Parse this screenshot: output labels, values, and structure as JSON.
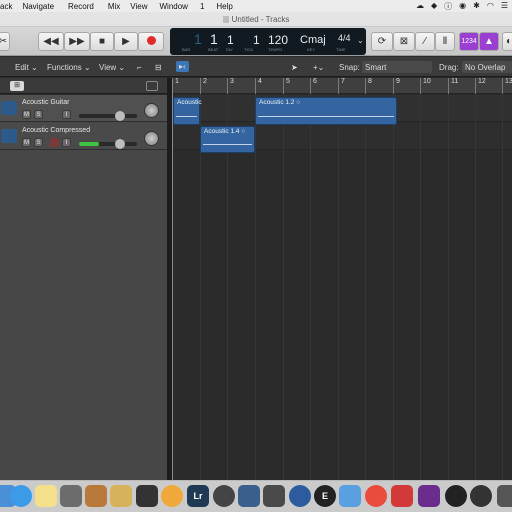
{
  "menubar": {
    "items": [
      "ack",
      "Navigate",
      "Record",
      "Mix",
      "View",
      "Window",
      "1",
      "Help"
    ],
    "status_icons": [
      "cloud-icon",
      "shield-icon",
      "info-icon",
      "circle-icon",
      "bluetooth-icon",
      "wifi-icon",
      "list-icon"
    ]
  },
  "window": {
    "title": "Untitled - Tracks"
  },
  "transport": {
    "bar": "1",
    "beat": "1",
    "div": "1",
    "tick": "1",
    "bar_label": "BAR",
    "beat_label": "BEAT",
    "div_label": "DIV",
    "tick_label": "TICK",
    "tempo": "120",
    "tempo_label": "TEMPO",
    "key": "Cmaj",
    "key_label": "KEY",
    "time_sig": "4/4",
    "time_label": "TIME",
    "count_in": "1234"
  },
  "secondbar": {
    "edit": "Edit",
    "functions": "Functions",
    "view": "View",
    "snap_label": "Snap:",
    "snap_value": "Smart",
    "drag_label": "Drag:",
    "drag_value": "No Overlap"
  },
  "ruler": {
    "ticks": [
      "1",
      "2",
      "3",
      "4",
      "5",
      "6",
      "7",
      "8",
      "9",
      "10",
      "11",
      "12",
      "13"
    ]
  },
  "tracks": [
    {
      "name": "Acoustic Guitar",
      "mute": "M",
      "solo": "S",
      "input": "I"
    },
    {
      "name": "Acoustic Compressed",
      "mute": "M",
      "solo": "S",
      "input": "I"
    }
  ],
  "regions": [
    {
      "name": "Acoustic",
      "track": 1
    },
    {
      "name": "Acoustic 1.2",
      "track": 1
    },
    {
      "name": "Acoustic 1.4",
      "track": 2
    }
  ],
  "dock": [
    "Lr",
    "E"
  ],
  "colors": {
    "region": "#3565a0",
    "accent": "#b04ad9"
  }
}
